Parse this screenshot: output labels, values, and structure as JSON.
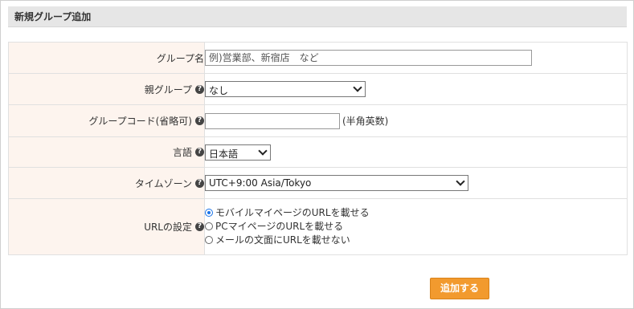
{
  "header": {
    "title": "新規グループ追加"
  },
  "form": {
    "group_name": {
      "label": "グループ名",
      "placeholder": "例)営業部、新宿店　など",
      "value": ""
    },
    "parent_group": {
      "label": "親グループ",
      "selected": "なし",
      "icon": "help-icon"
    },
    "group_code": {
      "label": "グループコード(省略可)",
      "value": "",
      "hint": "(半角英数)",
      "icon": "help-icon"
    },
    "language": {
      "label": "言語",
      "selected": "日本語",
      "icon": "help-icon"
    },
    "timezone": {
      "label": "タイムゾーン",
      "selected": "UTC+9:00 Asia/Tokyo",
      "icon": "help-icon"
    },
    "url_setting": {
      "label": "URLの設定",
      "icon": "help-icon",
      "options": [
        {
          "label": "モバイルマイページのURLを載せる",
          "checked": true
        },
        {
          "label": "PCマイページのURLを載せる",
          "checked": false
        },
        {
          "label": "メールの文面にURLを載せない",
          "checked": false
        }
      ]
    }
  },
  "help_glyph": "?",
  "submit": {
    "label": "追加する",
    "color": "#f29a2e"
  },
  "colors": {
    "label_bg": "#fdf4ee",
    "header_bg": "#e6e6e6",
    "radio_accent": "#1a73e8"
  }
}
